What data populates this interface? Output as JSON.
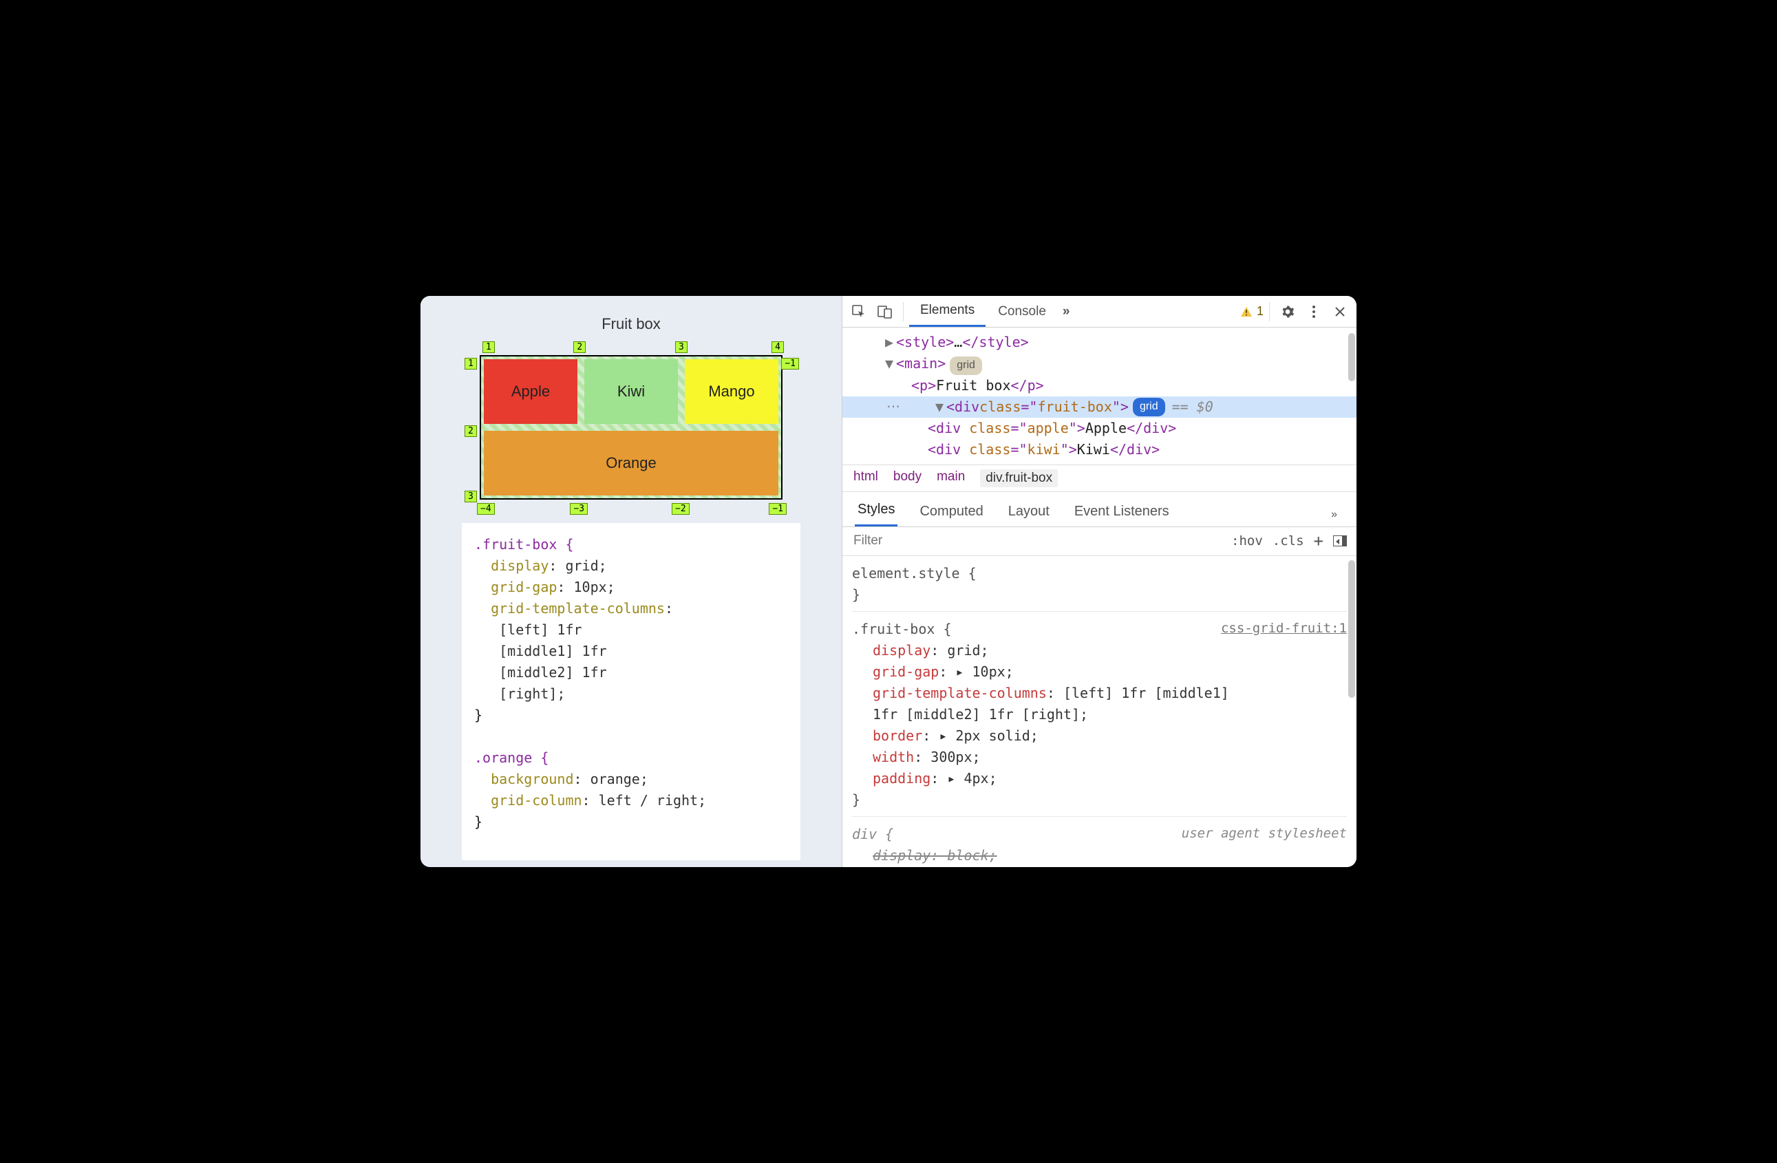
{
  "preview": {
    "title": "Fruit box",
    "cells": {
      "apple": "Apple",
      "kiwi": "Kiwi",
      "mango": "Mango",
      "orange": "Orange"
    },
    "top_labels": [
      "1",
      "2",
      "3",
      "4"
    ],
    "bottom_labels": [
      "−4",
      "−3",
      "−2",
      "−1"
    ],
    "left_labels": [
      "1",
      "2",
      "3"
    ],
    "right_labels": [
      "−1"
    ]
  },
  "code_snippet": {
    "rule1_selector": ".fruit-box {",
    "rule1_lines": [
      [
        "display",
        ": grid;"
      ],
      [
        "grid-gap",
        ": 10px;"
      ],
      [
        "grid-template-columns",
        ":"
      ],
      [
        "",
        "  [left] 1fr"
      ],
      [
        "",
        "  [middle1] 1fr"
      ],
      [
        "",
        "  [middle2] 1fr"
      ],
      [
        "",
        "  [right];"
      ]
    ],
    "rule1_close": "}",
    "rule2_selector": ".orange {",
    "rule2_lines": [
      [
        "background",
        ": orange;"
      ],
      [
        "grid-column",
        ": left / right;"
      ]
    ],
    "rule2_close": "}"
  },
  "devtools": {
    "tabs": {
      "elements": "Elements",
      "console": "Console"
    },
    "more": "»",
    "warn_count": "1",
    "dom": {
      "l1_style_open": "<style>",
      "l1_ellipsis": "…",
      "l1_style_close": "</style>",
      "l2_main": "<main>",
      "l2_badge": "grid",
      "l3": "<p>Fruit box</p>",
      "l4_open": "<div class=\"fruit-box\">",
      "l4_badge": "grid",
      "l4_eq": " == $0",
      "l5": "<div class=\"apple\">Apple</div>",
      "l6": "<div class=\"kiwi\">Kiwi</div>"
    },
    "breadcrumb": [
      "html",
      "body",
      "main",
      "div.fruit-box"
    ],
    "sub_tabs": {
      "styles": "Styles",
      "computed": "Computed",
      "layout": "Layout",
      "events": "Event Listeners"
    },
    "filter_placeholder": "Filter",
    "hov": ":hov",
    "cls": ".cls",
    "styles": {
      "element_style": "element.style {",
      "close": "}",
      "rule_sel": ".fruit-box {",
      "rule_src": "css-grid-fruit:1",
      "decls": [
        [
          "display",
          ": grid;"
        ],
        [
          "grid-gap",
          ": ▸ 10px;"
        ],
        [
          "grid-template-columns",
          ": [left] 1fr [middle1] 1fr [middle2] 1fr [right];"
        ],
        [
          "border",
          ": ▸ 2px solid;"
        ],
        [
          "width",
          ": 300px;"
        ],
        [
          "padding",
          ": ▸ 4px;"
        ]
      ],
      "ua_sel": "div {",
      "ua_src": "user agent stylesheet",
      "ua_decl": [
        "display",
        ": block;"
      ]
    }
  }
}
